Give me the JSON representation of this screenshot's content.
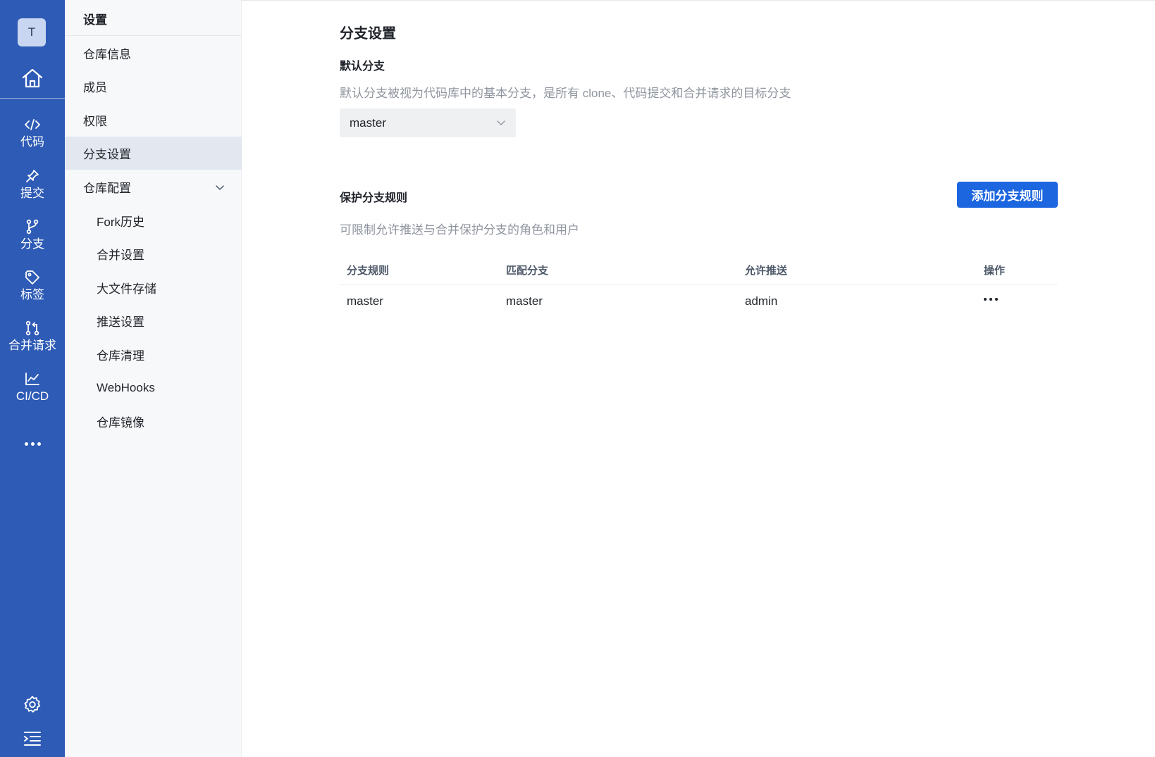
{
  "rail": {
    "avatar_letter": "T",
    "items": [
      {
        "label": "代码",
        "icon": "code-icon"
      },
      {
        "label": "提交",
        "icon": "pin-icon"
      },
      {
        "label": "分支",
        "icon": "branch-icon"
      },
      {
        "label": "标签",
        "icon": "tag-icon"
      },
      {
        "label": "合并请求",
        "icon": "merge-request-icon"
      },
      {
        "label": "CI/CD",
        "icon": "chart-line-icon"
      }
    ]
  },
  "sidebar": {
    "title": "设置",
    "items": [
      {
        "label": "仓库信息"
      },
      {
        "label": "成员"
      },
      {
        "label": "权限"
      },
      {
        "label": "分支设置",
        "active": true
      },
      {
        "label": "仓库配置",
        "expanded": true
      }
    ],
    "sub_items": [
      {
        "label": "Fork历史"
      },
      {
        "label": "合并设置"
      },
      {
        "label": "大文件存储"
      },
      {
        "label": "推送设置"
      },
      {
        "label": "仓库清理"
      },
      {
        "label": "WebHooks"
      },
      {
        "label": "仓库镜像"
      }
    ]
  },
  "main": {
    "title": "分支设置",
    "default_branch": {
      "title": "默认分支",
      "description": "默认分支被视为代码库中的基本分支，是所有 clone、代码提交和合并请求的目标分支",
      "selected": "master"
    },
    "protected": {
      "title": "保护分支规则",
      "description": "可限制允许推送与合并保护分支的角色和用户",
      "add_button": "添加分支规则",
      "columns": [
        "分支规则",
        "匹配分支",
        "允许推送",
        "操作"
      ],
      "rows": [
        {
          "rule": "master",
          "match": "master",
          "push": "admin"
        }
      ]
    }
  },
  "colors": {
    "rail_bg": "#2e5bb5",
    "primary_button": "#1c66e0",
    "active_item_bg": "#e3e7ef"
  }
}
